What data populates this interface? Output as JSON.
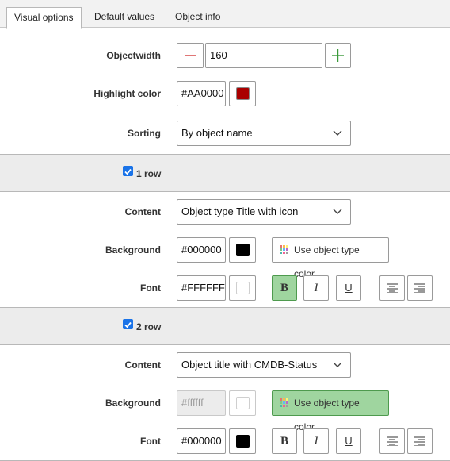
{
  "tabs": [
    "Visual options",
    "Default values",
    "Object info"
  ],
  "visual": {
    "objectwidth_label": "Objectwidth",
    "objectwidth_value": "160",
    "highlight_label": "Highlight color",
    "highlight_value": "#AA0000",
    "highlight_color": "#AA0000",
    "sorting_label": "Sorting",
    "sorting_value": "By object name"
  },
  "row1": {
    "section_label": "1 row",
    "checked": true,
    "content_label": "Content",
    "content_value": "Object type Title with icon",
    "background_label": "Background",
    "background_value": "#000000",
    "background_color": "#000000",
    "use_object_type_color": "Use object type color",
    "use_object_type_color_active": false,
    "font_label": "Font",
    "font_value": "#FFFFFF",
    "font_color": "#FFFFFF",
    "bold_active": true,
    "italic_active": false,
    "underline_active": false
  },
  "row2": {
    "section_label": "2 row",
    "checked": true,
    "content_label": "Content",
    "content_value": "Object title with CMDB-Status",
    "background_label": "Background",
    "background_value": "#ffffff",
    "background_color": "#FFFFFF",
    "use_object_type_color": "Use object type color",
    "use_object_type_color_active": true,
    "font_label": "Font",
    "font_value": "#000000",
    "font_color": "#000000",
    "bold_active": false,
    "italic_active": false,
    "underline_active": false
  },
  "format_glyphs": {
    "bold": "B",
    "italic": "I",
    "underline": "U"
  },
  "colors": {
    "accent_red": "#AA0000",
    "active_green": "#9FD59F",
    "section_bg": "#ECECEC"
  }
}
